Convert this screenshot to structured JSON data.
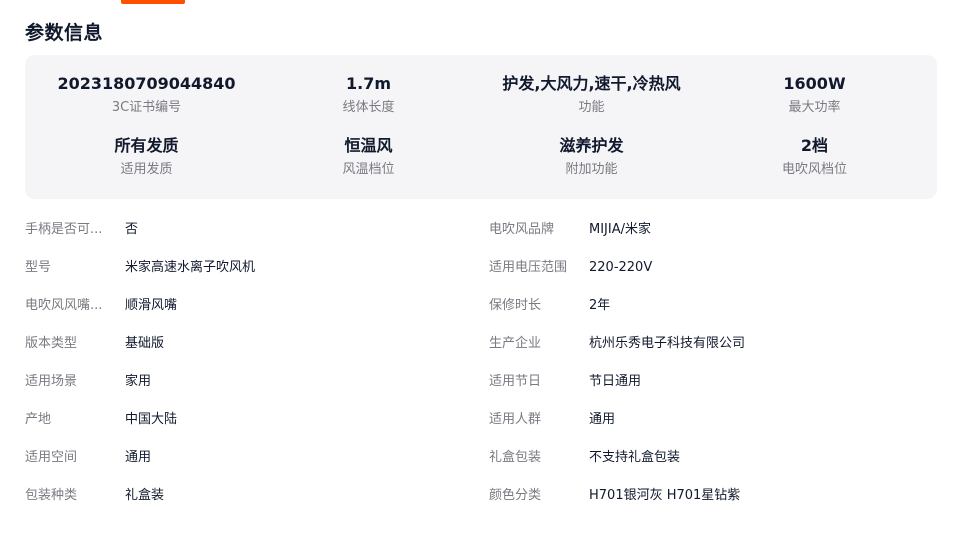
{
  "section": {
    "title": "参数信息"
  },
  "key_params": [
    {
      "value": "2023180709044840",
      "label": "3C证书编号"
    },
    {
      "value": "1.7m",
      "label": "线体长度"
    },
    {
      "value": "护发,大风力,速干,冷热风",
      "label": "功能"
    },
    {
      "value": "1600W",
      "label": "最大功率"
    },
    {
      "value": "所有发质",
      "label": "适用发质"
    },
    {
      "value": "恒温风",
      "label": "风温档位"
    },
    {
      "value": "滋养护发",
      "label": "附加功能"
    },
    {
      "value": "2档",
      "label": "电吹风档位"
    }
  ],
  "specs_left": [
    {
      "label": "手柄是否可...",
      "value": "否"
    },
    {
      "label": "型号",
      "value": "米家高速水离子吹风机"
    },
    {
      "label": "电吹风风嘴...",
      "value": "顺滑风嘴"
    },
    {
      "label": "版本类型",
      "value": "基础版"
    },
    {
      "label": "适用场景",
      "value": "家用"
    },
    {
      "label": "产地",
      "value": "中国大陆"
    },
    {
      "label": "适用空间",
      "value": "通用"
    },
    {
      "label": "包装种类",
      "value": "礼盒装"
    }
  ],
  "specs_right": [
    {
      "label": "电吹风品牌",
      "value": "MIJIA/米家"
    },
    {
      "label": "适用电压范围",
      "value": "220-220V"
    },
    {
      "label": "保修时长",
      "value": "2年"
    },
    {
      "label": "生产企业",
      "value": "杭州乐秀电子科技有限公司"
    },
    {
      "label": "适用节日",
      "value": "节日通用"
    },
    {
      "label": "适用人群",
      "value": "通用"
    },
    {
      "label": "礼盒包装",
      "value": "不支持礼盒包装"
    },
    {
      "label": "颜色分类",
      "value": "H701银河灰 H701星钻紫"
    }
  ],
  "colors": {
    "accent": "#ff5000",
    "card_bg": "#f5f5f7",
    "label": "#7a7a82",
    "text": "#11192d"
  }
}
